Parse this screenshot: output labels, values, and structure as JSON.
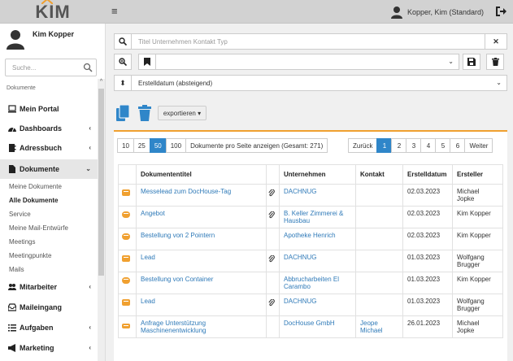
{
  "topbar": {
    "logo_text": "KIM",
    "user_name": "Kopper, Kim (Standard)"
  },
  "sidebar": {
    "user_name": "Kim Kopper",
    "search_placeholder": "Suche...",
    "section_label": "Dokumente",
    "items": [
      {
        "label": "Mein Portal",
        "icon": "laptop-icon",
        "chevron": ""
      },
      {
        "label": "Dashboards",
        "icon": "dashboard-icon",
        "chevron": "‹"
      },
      {
        "label": "Adressbuch",
        "icon": "addressbook-icon",
        "chevron": "‹"
      },
      {
        "label": "Dokumente",
        "icon": "document-icon",
        "chevron": "⌄"
      },
      {
        "label": "Mitarbeiter",
        "icon": "users-icon",
        "chevron": "‹"
      },
      {
        "label": "Maileingang",
        "icon": "inbox-icon",
        "chevron": ""
      },
      {
        "label": "Aufgaben",
        "icon": "tasks-icon",
        "chevron": "‹"
      },
      {
        "label": "Marketing",
        "icon": "megaphone-icon",
        "chevron": "‹"
      }
    ],
    "subitems": [
      "Meine Dokumente",
      "Alle Dokumente",
      "Service",
      "Meine Mail-Entwürfe",
      "Meetings",
      "Meetingpunkte",
      "Mails"
    ]
  },
  "filters": {
    "search_placeholder": "Titel Unternehmen Kontakt Typ",
    "sort_value": "Erstelldatum (absteigend)"
  },
  "toolbar": {
    "export_label": "exportieren ▾"
  },
  "pagination": {
    "sizes": [
      "10",
      "25",
      "50",
      "100"
    ],
    "active_size": "50",
    "info": "Dokumente pro Seite anzeigen (Gesamt: 271)",
    "prev": "Zurück",
    "pages": [
      "1",
      "2",
      "3",
      "4",
      "5",
      "6"
    ],
    "active_page": "1",
    "next": "Weiter"
  },
  "table": {
    "headers": [
      "Dokumententitel",
      "Unternehmen",
      "Kontakt",
      "Erstelldatum",
      "Ersteller"
    ],
    "rows": [
      {
        "title": "Messelead zum DocHouse-Tag",
        "clip": true,
        "company": "DACHNUG",
        "contact": "",
        "date": "02.03.2023",
        "creator": "Michael Jopke",
        "type": "lead"
      },
      {
        "title": "Angebot",
        "clip": true,
        "company": "B. Keller Zimmerei & Hausbau",
        "contact": "",
        "date": "02.03.2023",
        "creator": "Kim Kopper",
        "type": "offer"
      },
      {
        "title": "Bestellung von 2 Pointern",
        "clip": false,
        "company": "Apotheke Henrich",
        "contact": "",
        "date": "02.03.2023",
        "creator": "Kim Kopper",
        "type": "offer"
      },
      {
        "title": "Lead",
        "clip": true,
        "company": "DACHNUG",
        "contact": "",
        "date": "01.03.2023",
        "creator": "Wolfgang Brugger",
        "type": "lead"
      },
      {
        "title": "Bestellung von Container",
        "clip": false,
        "company": "Abbrucharbeiten El Carambo",
        "contact": "",
        "date": "01.03.2023",
        "creator": "Kim Kopper",
        "type": "offer"
      },
      {
        "title": "Lead",
        "clip": true,
        "company": "DACHNUG",
        "contact": "",
        "date": "01.03.2023",
        "creator": "Wolfgang Brugger",
        "type": "lead"
      },
      {
        "title": "Anfrage Unterstützung Maschinenentwicklung",
        "clip": false,
        "company": "DocHouse GmbH",
        "contact": "Jeope Michael",
        "date": "26.01.2023",
        "creator": "Michael Jopke",
        "type": "request"
      }
    ]
  },
  "colors": {
    "accent": "#2f86c9",
    "orange": "#f0a030"
  }
}
